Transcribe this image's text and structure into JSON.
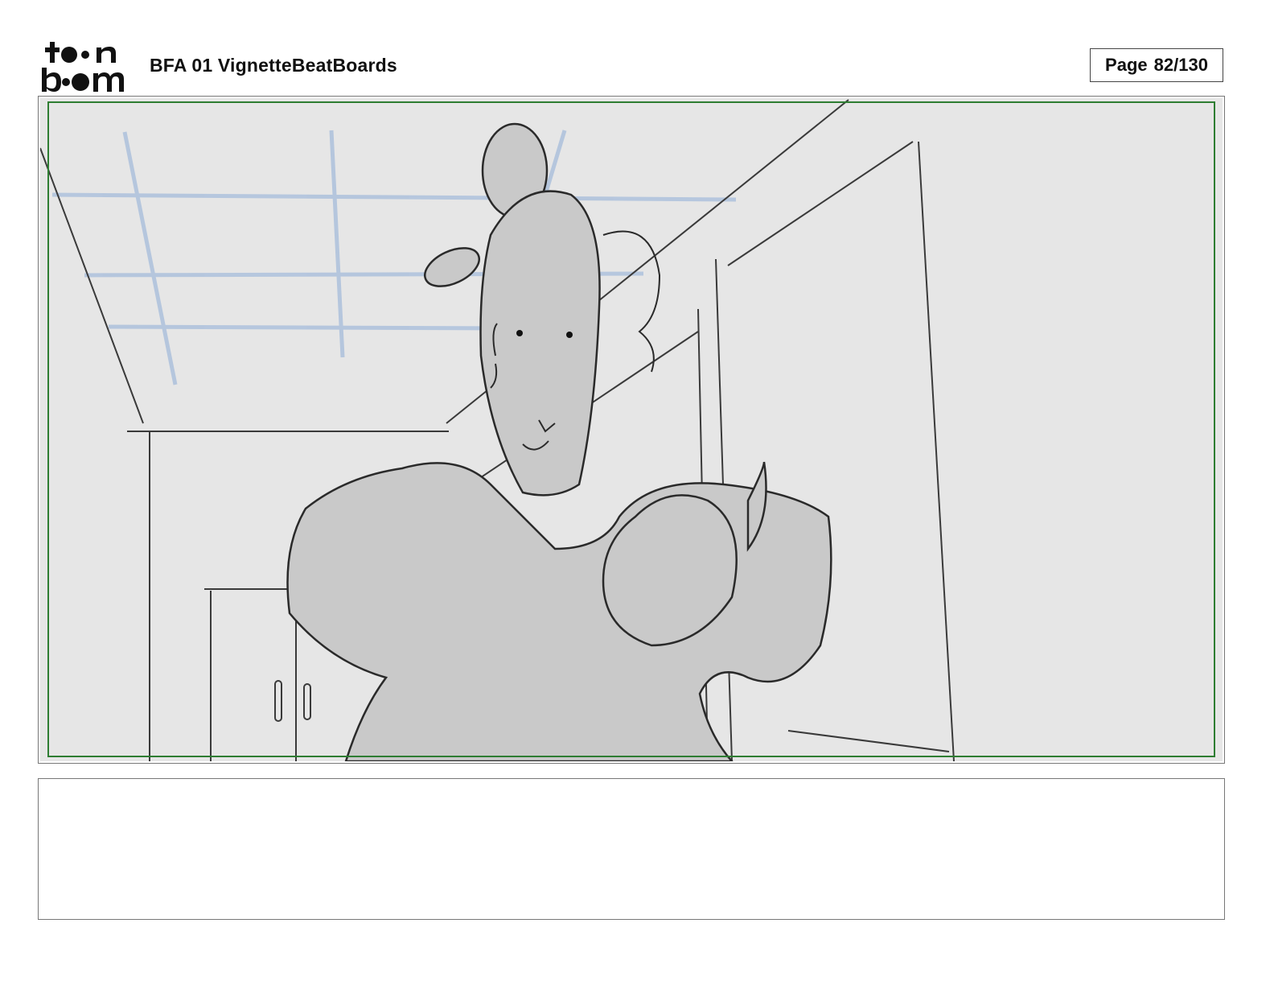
{
  "header": {
    "logo_top": "toon",
    "logo_bottom": "boom",
    "document_title": "BFA 01 VignetteBeatBoards",
    "page_label": "Page",
    "page_number": "82/130"
  },
  "panel": {
    "image_icon": "storyboard-sketch",
    "safe_area_color": "#2e7d32"
  },
  "notes": {
    "text": ""
  }
}
